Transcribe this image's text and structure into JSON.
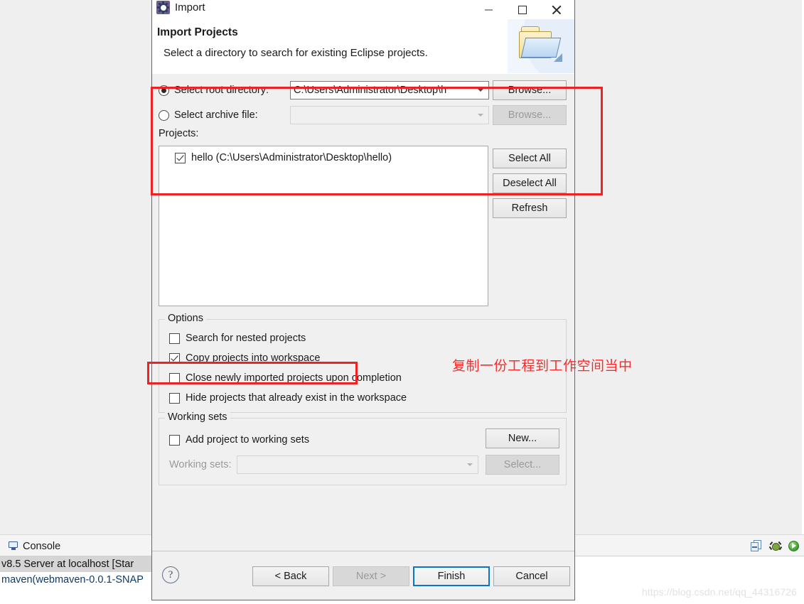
{
  "workbench": {
    "console_tab_label": "Console",
    "console_icon": "console-icon",
    "console_lines": [
      "v8.5 Server at localhost  [Star",
      "maven(webmaven-0.0.1-SNAP"
    ],
    "toolbar_icons": [
      "remove-all-terminated-icon",
      "debug-icon",
      "run-icon"
    ],
    "watermark": "https://blog.csdn.net/qq_44316726"
  },
  "dialog": {
    "title": "Import",
    "title_icon": "import-gear-icon",
    "window_buttons": {
      "minimize": "minimize-icon",
      "maximize": "maximize-icon",
      "close": "close-icon"
    },
    "header": {
      "title": "Import Projects",
      "description": "Select a directory to search for existing Eclipse projects.",
      "image": "folder-icon"
    },
    "source": {
      "root_directory_label": "Select root directory:",
      "root_directory_value": "C:\\Users\\Administrator\\Desktop\\h",
      "root_directory_selected": true,
      "archive_file_label": "Select archive file:",
      "archive_file_value": "",
      "archive_file_selected": false,
      "browse_dir_label": "Browse...",
      "browse_archive_label": "Browse..."
    },
    "projects": {
      "label": "Projects:",
      "items": [
        {
          "label": "hello (C:\\Users\\Administrator\\Desktop\\hello)",
          "checked": true
        }
      ],
      "select_all_label": "Select All",
      "deselect_all_label": "Deselect All",
      "refresh_label": "Refresh"
    },
    "options": {
      "group_title": "Options",
      "items": [
        {
          "label": "Search for nested projects",
          "checked": false
        },
        {
          "label": "Copy projects into workspace",
          "checked": true
        },
        {
          "label": "Close newly imported projects upon completion",
          "checked": false
        },
        {
          "label": "Hide projects that already exist in the workspace",
          "checked": false
        }
      ]
    },
    "working_sets": {
      "group_title": "Working sets",
      "add_label": "Add project to working sets",
      "add_checked": false,
      "combo_label": "Working sets:",
      "combo_value": "",
      "new_label": "New...",
      "select_label": "Select..."
    },
    "buttons": {
      "help": "?",
      "back": "< Back",
      "next": "Next >",
      "finish": "Finish",
      "cancel": "Cancel"
    }
  },
  "annotations": {
    "note_text": "复制一份工程到工作空间当中",
    "color": "#fb2b2b"
  }
}
